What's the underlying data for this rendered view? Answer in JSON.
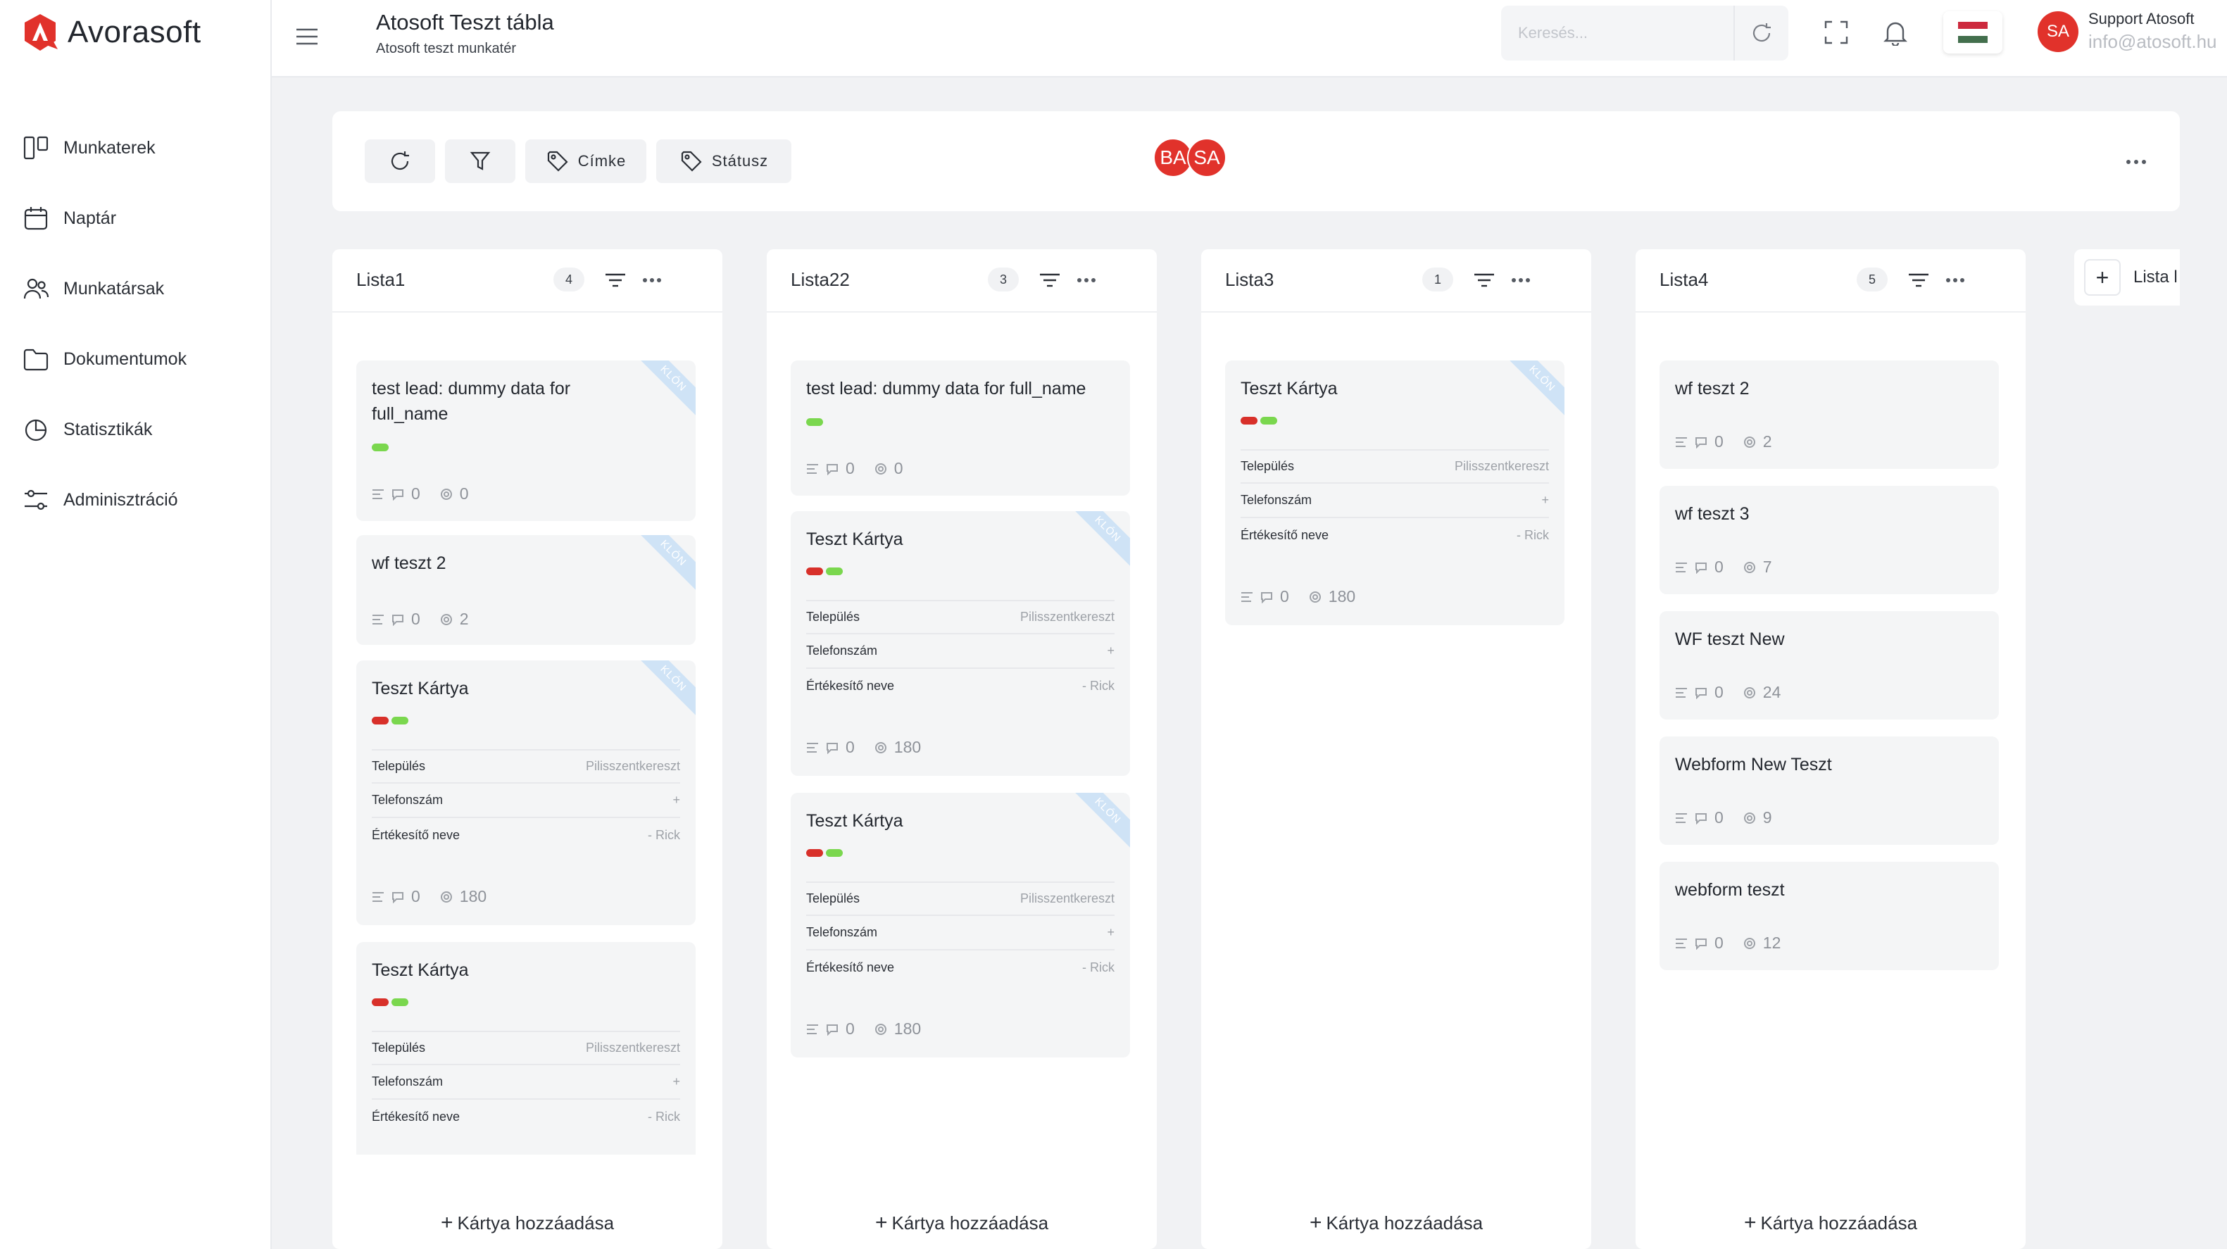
{
  "app": {
    "logo_text": "Avorasoft"
  },
  "sidebar": {
    "items": [
      {
        "label": "Munkaterek",
        "icon": "workspace-icon"
      },
      {
        "label": "Naptár",
        "icon": "calendar-icon"
      },
      {
        "label": "Munkatársak",
        "icon": "users-icon"
      },
      {
        "label": "Dokumentumok",
        "icon": "folder-icon"
      },
      {
        "label": "Statisztikák",
        "icon": "chart-icon"
      },
      {
        "label": "Adminisztráció",
        "icon": "settings-sliders-icon"
      }
    ]
  },
  "header": {
    "title": "Atosoft Teszt tábla",
    "subtitle": "Atosoft teszt munkatér",
    "search_placeholder": "Keresés...",
    "user_initials": "SA",
    "user_name": "Support Atosoft",
    "user_email": "info@atosoft.hu",
    "flag_colors": [
      "#cd2a3e",
      "#ffffff",
      "#436f4d"
    ]
  },
  "toolbar": {
    "label_button": "Címke",
    "status_button": "Státusz",
    "members": [
      "BA",
      "SA"
    ]
  },
  "colors": {
    "accent": "#e1322b",
    "label_red": "#d8302a",
    "label_green": "#7ad74e",
    "ribbon": "#cfe3f6"
  },
  "columns": [
    {
      "title": "Lista1",
      "count": "4",
      "add_label": "Kártya hozzáadása",
      "cards": [
        {
          "title": "test lead: dummy data for full_name",
          "ribbon": "KLÓN",
          "comments": "0",
          "attachments": "0"
        },
        {
          "title": "wf teszt 2",
          "ribbon": "KLÓN",
          "comments": "0",
          "attachments": "2"
        },
        {
          "title": "Teszt Kártya",
          "ribbon": "KLÓN",
          "comments": "0",
          "attachments": "180",
          "fields": [
            {
              "k": "Település",
              "v": "Pilisszentkereszt"
            },
            {
              "k": "Telefonszám",
              "v": "+"
            },
            {
              "k": "Értékesítő neve",
              "v": "- Rick"
            }
          ]
        },
        {
          "title": "Teszt Kártya",
          "fields": [
            {
              "k": "Település",
              "v": "Pilisszentkereszt"
            },
            {
              "k": "Telefonszám",
              "v": "+"
            },
            {
              "k": "Értékesítő neve",
              "v": "- Rick"
            }
          ]
        }
      ]
    },
    {
      "title": "Lista22",
      "count": "3",
      "add_label": "Kártya hozzáadása",
      "cards": [
        {
          "title": "test lead: dummy data for full_name",
          "comments": "0",
          "attachments": "0"
        },
        {
          "title": "Teszt Kártya",
          "ribbon": "KLÓN",
          "comments": "0",
          "attachments": "180",
          "fields": [
            {
              "k": "Település",
              "v": "Pilisszentkereszt"
            },
            {
              "k": "Telefonszám",
              "v": "+"
            },
            {
              "k": "Értékesítő neve",
              "v": "- Rick"
            }
          ]
        },
        {
          "title": "Teszt Kártya",
          "ribbon": "KLÓN",
          "comments": "0",
          "attachments": "180",
          "fields": [
            {
              "k": "Település",
              "v": "Pilisszentkereszt"
            },
            {
              "k": "Telefonszám",
              "v": "+"
            },
            {
              "k": "Értékesítő neve",
              "v": "- Rick"
            }
          ]
        }
      ]
    },
    {
      "title": "Lista3",
      "count": "1",
      "add_label": "Kártya hozzáadása",
      "cards": [
        {
          "title": "Teszt Kártya",
          "ribbon": "KLÓN",
          "comments": "0",
          "attachments": "180",
          "fields": [
            {
              "k": "Település",
              "v": "Pilisszentkereszt"
            },
            {
              "k": "Telefonszám",
              "v": "+"
            },
            {
              "k": "Értékesítő neve",
              "v": "- Rick"
            }
          ]
        }
      ]
    },
    {
      "title": "Lista4",
      "count": "5",
      "add_label": "Kártya hozzáadása",
      "cards": [
        {
          "title": "wf teszt 2",
          "comments": "0",
          "attachments": "2"
        },
        {
          "title": "wf teszt 3",
          "comments": "0",
          "attachments": "7"
        },
        {
          "title": "WF teszt New",
          "comments": "0",
          "attachments": "24"
        },
        {
          "title": "Webform New Teszt",
          "comments": "0",
          "attachments": "9"
        },
        {
          "title": "webform teszt",
          "comments": "0",
          "attachments": "12"
        }
      ]
    }
  ],
  "add_list_label": "Lista l"
}
